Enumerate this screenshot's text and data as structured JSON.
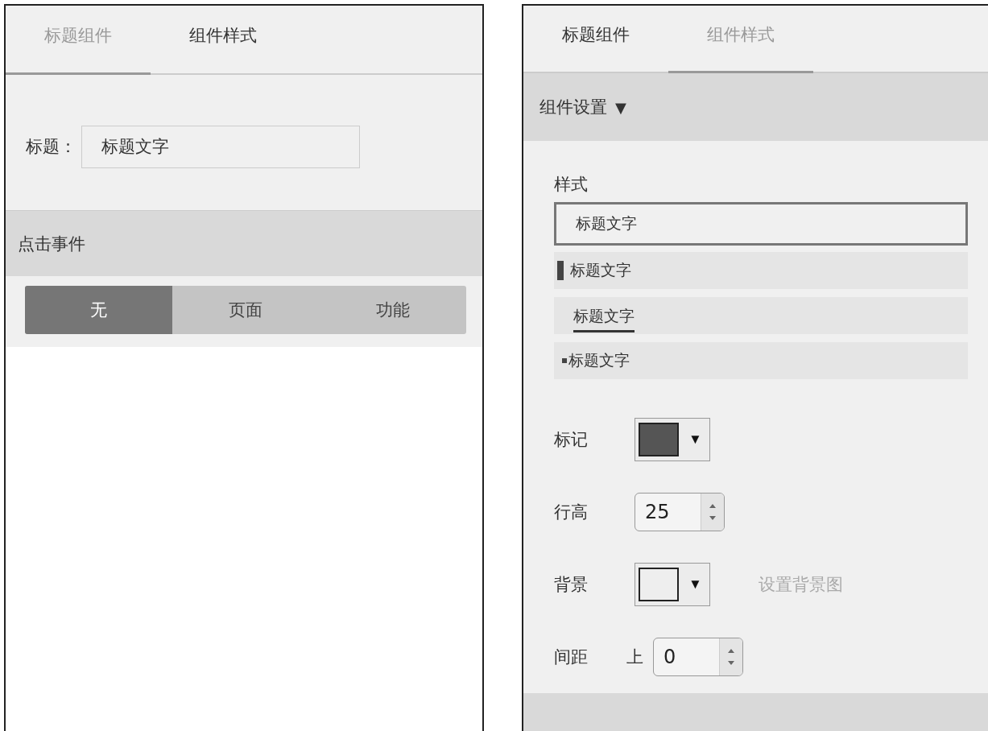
{
  "left_panel": {
    "tabs": [
      {
        "label": "标题组件",
        "selected": true
      },
      {
        "label": "组件样式",
        "selected": false
      }
    ],
    "title_field": {
      "label": "标题：",
      "value": "标题文字"
    },
    "click_event": {
      "header": "点击事件",
      "options": [
        {
          "label": "无",
          "selected": true
        },
        {
          "label": "页面",
          "selected": false
        },
        {
          "label": "功能",
          "selected": false
        }
      ]
    }
  },
  "right_panel": {
    "tabs": [
      {
        "label": "标题组件",
        "selected": false
      },
      {
        "label": "组件样式",
        "selected": true
      }
    ],
    "component_settings": {
      "header": "组件设置",
      "caret": "▼",
      "expanded": true,
      "style_label": "样式",
      "styles": [
        {
          "kind": "plain",
          "text": "标题文字",
          "selected": true
        },
        {
          "kind": "bar",
          "text": "标题文字",
          "selected": false
        },
        {
          "kind": "underline",
          "text": "标题文字",
          "selected": false
        },
        {
          "kind": "dot",
          "text": "标题文字",
          "selected": false
        }
      ],
      "marker": {
        "label": "标记",
        "color": "#555555",
        "caret": "▼"
      },
      "line_height": {
        "label": "行高",
        "value": "25"
      },
      "background": {
        "label": "背景",
        "color": "#eeeeee",
        "caret": "▼",
        "link": "设置背景图"
      },
      "spacing": {
        "label": "间距",
        "side": "上",
        "value": "0"
      }
    }
  }
}
